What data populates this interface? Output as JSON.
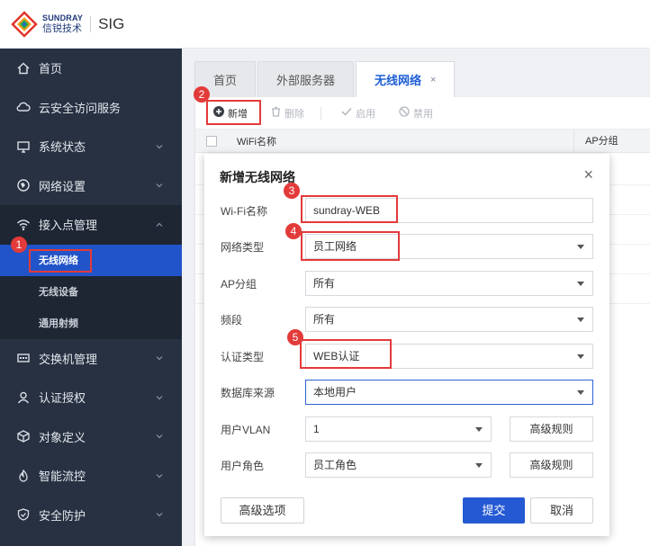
{
  "header": {
    "brand_en": "SUNDRAY",
    "brand_cn": "信锐技术",
    "product": "SIG"
  },
  "sidebar": {
    "items": [
      {
        "label": "首页",
        "icon": "home-icon"
      },
      {
        "label": "云安全访问服务",
        "icon": "cloud-lock-icon"
      },
      {
        "label": "系统状态",
        "icon": "monitor-icon"
      },
      {
        "label": "网络设置",
        "icon": "globe-icon"
      },
      {
        "label": "接入点管理",
        "icon": "wifi-icon"
      },
      {
        "label": "交换机管理",
        "icon": "switch-icon"
      },
      {
        "label": "认证授权",
        "icon": "user-icon"
      },
      {
        "label": "对象定义",
        "icon": "cube-icon"
      },
      {
        "label": "智能流控",
        "icon": "flame-icon"
      },
      {
        "label": "安全防护",
        "icon": "shield-icon"
      }
    ],
    "sub_items": [
      "无线网络",
      "无线设备",
      "通用射频"
    ]
  },
  "tabs": [
    {
      "label": "首页"
    },
    {
      "label": "外部服务器"
    },
    {
      "label": "无线网络",
      "close": "×"
    }
  ],
  "toolbar": {
    "add": "新增",
    "delete": "删除",
    "enable": "启用",
    "disable": "禁用"
  },
  "table": {
    "col_wifi": "WiFi名称",
    "col_ap": "AP分组"
  },
  "modal": {
    "title": "新增无线网络",
    "close": "×",
    "fields": {
      "wifi_name": {
        "label": "Wi-Fi名称",
        "value": "sundray-WEB"
      },
      "network_type": {
        "label": "网络类型",
        "value": "员工网络"
      },
      "ap_group": {
        "label": "AP分组",
        "value": "所有"
      },
      "band": {
        "label": "频段",
        "value": "所有"
      },
      "auth_type": {
        "label": "认证类型",
        "value": "WEB认证"
      },
      "db_source": {
        "label": "数据库来源",
        "value": "本地用户"
      },
      "user_vlan": {
        "label": "用户VLAN",
        "value": "1",
        "adv": "高级规则"
      },
      "user_role": {
        "label": "用户角色",
        "value": "员工角色",
        "adv": "高级规则"
      }
    },
    "advanced_options": "高级选项",
    "submit": "提交",
    "cancel": "取消"
  },
  "annotations": [
    "1",
    "2",
    "3",
    "4",
    "5"
  ],
  "colors": {
    "sidebar_bg": "#273142",
    "active_blue": "#2254c9",
    "annotation_red": "#e33a3a"
  }
}
